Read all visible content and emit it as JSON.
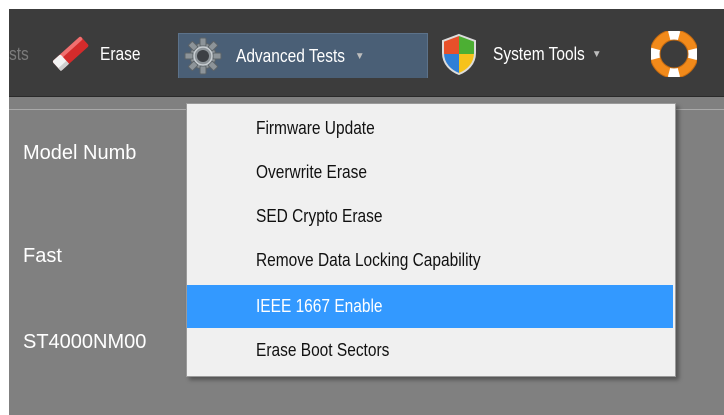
{
  "toolbar": {
    "partial_label": "sts",
    "erase_label": "Erase",
    "advanced_label": "Advanced Tests",
    "system_tools_label": "System Tools",
    "icons": {
      "erase": "eraser-icon",
      "advanced": "gear-icon",
      "system_tools": "shield-icon",
      "help": "lifebuoy-icon"
    }
  },
  "background": {
    "model_label": "Model Numb",
    "speed_value": "Fast",
    "model_value": "ST4000NM00"
  },
  "advanced_menu": {
    "items": [
      {
        "label": "Firmware Update"
      },
      {
        "label": "Overwrite Erase"
      },
      {
        "label": "SED Crypto Erase"
      },
      {
        "label": "Remove Data Locking Capability"
      },
      {
        "label": "IEEE 1667 Enable",
        "highlighted": true
      },
      {
        "label": "Erase Boot Sectors"
      }
    ]
  },
  "colors": {
    "highlight": "#3399ff",
    "toolbar": "#3c3c3c",
    "panel": "#808080"
  }
}
